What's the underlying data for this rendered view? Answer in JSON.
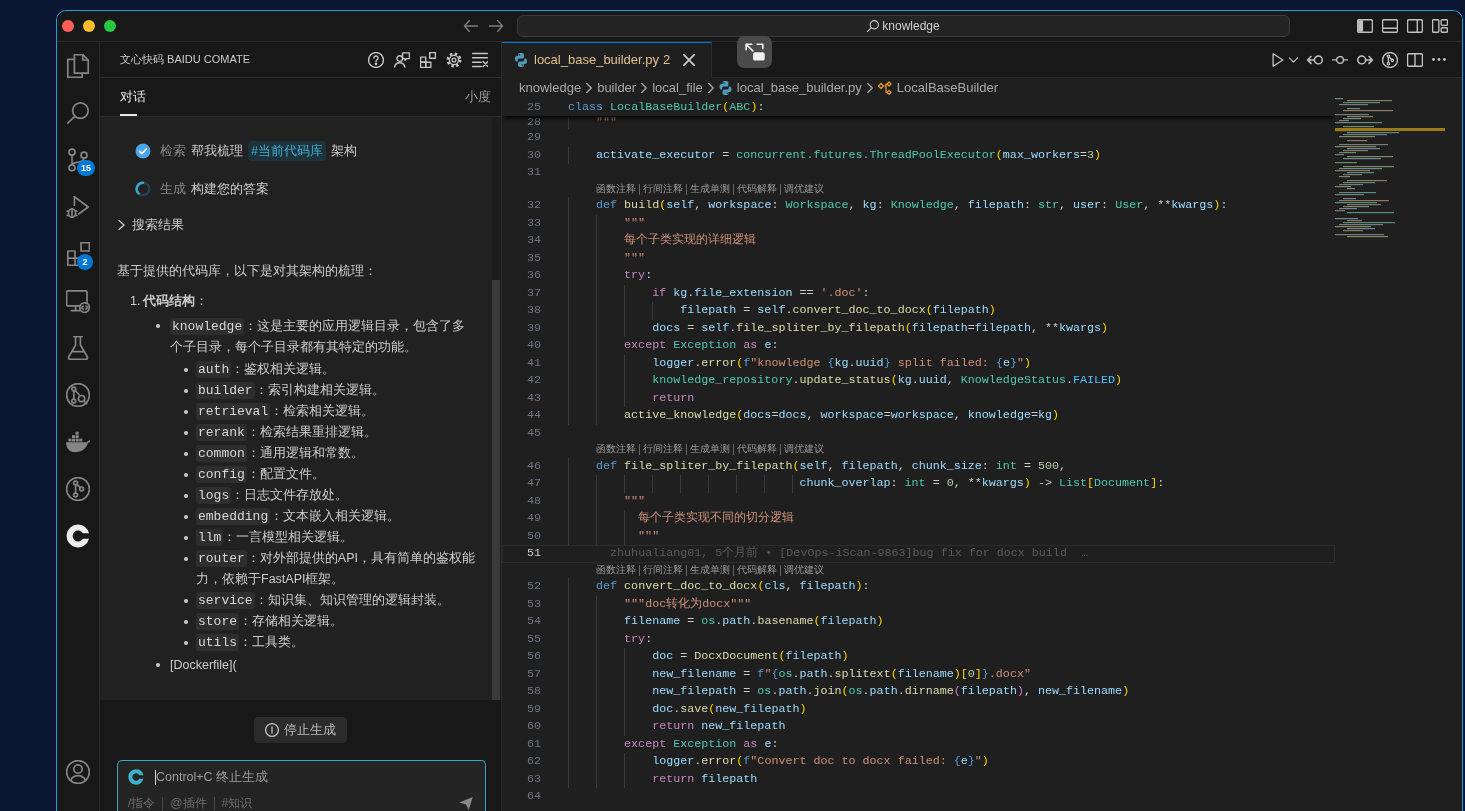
{
  "window": {
    "search": "knowledge"
  },
  "activity_bar": {
    "items": [
      {
        "selected": false
      },
      {
        "selected": false
      },
      {
        "selected": false,
        "badge": "15"
      },
      {
        "selected": false
      },
      {
        "selected": false,
        "badge": "2"
      },
      {
        "selected": false
      },
      {
        "selected": false
      },
      {
        "selected": false
      },
      {
        "selected": false
      },
      {
        "selected": false
      },
      {
        "selected": true
      }
    ]
  },
  "side_panel": {
    "title": "文心快码 BAIDU COMATE",
    "tabs": [
      {
        "label": "对话",
        "selected": true
      },
      {
        "label": "小度",
        "selected": false
      }
    ],
    "chat": {
      "steps": [
        {
          "done": true,
          "label": "检索",
          "parts": [
            {
              "kind": "text",
              "text": "帮我梳理"
            },
            {
              "kind": "tag",
              "text": "#当前代码库"
            },
            {
              "kind": "text",
              "text": "架构"
            }
          ]
        },
        {
          "done": false,
          "label": "生成",
          "parts": [
            {
              "kind": "text",
              "text": "构建您的答案"
            }
          ]
        }
      ],
      "search_results": {
        "label": "搜索结果",
        "expanded": false
      },
      "answer": {
        "intro": "基于提供的代码库，以下是对其架构的梳理：",
        "sections": [
          {
            "number": "1.",
            "heading": "**代码结构**：",
            "items": [
              {
                "code": "knowledge",
                "text": "：这是主要的应用逻辑目录，包含了多个子目录，每个子目录都有其特定的功能。",
                "children": [
                  {
                    "code": "auth",
                    "text": "：鉴权相关逻辑。"
                  },
                  {
                    "code": "builder",
                    "text": "：索引构建相关逻辑。"
                  },
                  {
                    "code": "retrieval",
                    "text": "：检索相关逻辑。"
                  },
                  {
                    "code": "rerank",
                    "text": "：检索结果重排逻辑。"
                  },
                  {
                    "code": "common",
                    "text": "：通用逻辑和常数。"
                  },
                  {
                    "code": "config",
                    "text": "：配置文件。"
                  },
                  {
                    "code": "logs",
                    "text": "：日志文件存放处。"
                  },
                  {
                    "code": "embedding",
                    "text": "：文本嵌入相关逻辑。"
                  },
                  {
                    "code": "llm",
                    "text": "：一言模型相关逻辑。"
                  },
                  {
                    "code": "router",
                    "text": "：对外部提供的API，具有简单的鉴权能力，依赖于FastAPI框架。"
                  },
                  {
                    "code": "service",
                    "text": "：知识集、知识管理的逻辑封装。"
                  },
                  {
                    "code": "store",
                    "text": "：存储相关逻辑。"
                  },
                  {
                    "code": "utils",
                    "text": "：工具类。"
                  }
                ]
              },
              {
                "text": "[Dockerfile]("
              }
            ]
          }
        ]
      }
    },
    "stop_button": "停止生成",
    "input": {
      "placeholder": "Control+C 终止生成",
      "focused": true,
      "shortcuts": [
        "/指令",
        "@插件",
        "#知识"
      ]
    }
  },
  "editor": {
    "tabs": [
      {
        "label": "local_base_builder.py",
        "problems": "2",
        "selected": true
      }
    ],
    "breadcrumb": [
      {
        "kind": "folder",
        "text": "knowledge"
      },
      {
        "kind": "folder",
        "text": "builder"
      },
      {
        "kind": "folder",
        "text": "local_file"
      },
      {
        "kind": "python",
        "text": "local_base_builder.py"
      },
      {
        "kind": "class",
        "text": "LocalBaseBuilder"
      }
    ],
    "sticky": {
      "number": "25",
      "tokens": [
        {
          "text": "class",
          "kind": "kw"
        },
        {
          "text": " LocalBaseBuilder",
          "kind": "type"
        },
        {
          "text": "(",
          "kind": "br1"
        },
        {
          "text": "ABC",
          "kind": "type"
        },
        {
          "text": ")",
          "kind": "br1"
        },
        {
          "text": ":",
          "kind": "op"
        }
      ]
    },
    "lines": [
      {
        "kind": "code",
        "number": "28",
        "current": false,
        "tokens": [
          {
            "text": "    \"\"\"",
            "kind": "str"
          }
        ]
      },
      {
        "kind": "code",
        "number": "29",
        "current": false
      },
      {
        "kind": "code",
        "number": "30",
        "current": false,
        "tokens": [
          {
            "text": "    activate_executor",
            "kind": "var"
          },
          {
            "text": " = ",
            "kind": "op"
          },
          {
            "text": "concurrent.futures.ThreadPoolExecutor",
            "kind": "type"
          },
          {
            "text": "(",
            "kind": "br1"
          },
          {
            "text": "max_workers",
            "kind": "var"
          },
          {
            "text": "=",
            "kind": "op"
          },
          {
            "text": "3",
            "kind": "num"
          },
          {
            "text": ")",
            "kind": "br1"
          }
        ]
      },
      {
        "kind": "code",
        "number": "31",
        "current": false
      },
      {
        "kind": "codelens",
        "links": [
          "函数注释",
          "行间注释",
          "生成单测",
          "代码解释",
          "调优建议"
        ]
      },
      {
        "kind": "code",
        "number": "32",
        "current": false,
        "tokens": [
          {
            "text": "    def",
            "kind": "kw"
          },
          {
            "text": " build",
            "kind": "fn"
          },
          {
            "text": "(",
            "kind": "br1"
          },
          {
            "text": "self",
            "kind": "var"
          },
          {
            "text": ", ",
            "kind": "op"
          },
          {
            "text": "workspace",
            "kind": "var"
          },
          {
            "text": ": ",
            "kind": "op"
          },
          {
            "text": "Workspace",
            "kind": "type"
          },
          {
            "text": ", ",
            "kind": "op"
          },
          {
            "text": "kg",
            "kind": "var"
          },
          {
            "text": ": ",
            "kind": "op"
          },
          {
            "text": "Knowledge",
            "kind": "type"
          },
          {
            "text": ", ",
            "kind": "op"
          },
          {
            "text": "filepath",
            "kind": "var"
          },
          {
            "text": ": ",
            "kind": "op"
          },
          {
            "text": "str",
            "kind": "type"
          },
          {
            "text": ", ",
            "kind": "op"
          },
          {
            "text": "user",
            "kind": "var"
          },
          {
            "text": ": ",
            "kind": "op"
          },
          {
            "text": "User",
            "kind": "type"
          },
          {
            "text": ", **",
            "kind": "op"
          },
          {
            "text": "kwargs",
            "kind": "var"
          },
          {
            "text": ")",
            "kind": "br1"
          },
          {
            "text": ":",
            "kind": "op"
          }
        ]
      },
      {
        "kind": "code",
        "number": "33",
        "current": false,
        "tokens": [
          {
            "text": "        \"\"\"",
            "kind": "str"
          }
        ]
      },
      {
        "kind": "code",
        "number": "34",
        "current": false,
        "tokens": [
          {
            "text": "        每个子类实现的详细逻辑",
            "kind": "str"
          }
        ]
      },
      {
        "kind": "code",
        "number": "35",
        "current": false,
        "tokens": [
          {
            "text": "        \"\"\"",
            "kind": "str"
          }
        ]
      },
      {
        "kind": "code",
        "number": "36",
        "current": false,
        "tokens": [
          {
            "text": "        try",
            "kind": "ctl"
          },
          {
            "text": ":",
            "kind": "op"
          }
        ]
      },
      {
        "kind": "code",
        "number": "37",
        "current": false,
        "tokens": [
          {
            "text": "            if",
            "kind": "ctl"
          },
          {
            "text": " kg",
            "kind": "var"
          },
          {
            "text": ".",
            "kind": "op"
          },
          {
            "text": "file_extension",
            "kind": "var"
          },
          {
            "text": " == ",
            "kind": "op"
          },
          {
            "text": "'.doc'",
            "kind": "str"
          },
          {
            "text": ":",
            "kind": "op"
          }
        ]
      },
      {
        "kind": "code",
        "number": "38",
        "current": false,
        "tokens": [
          {
            "text": "                filepath",
            "kind": "var"
          },
          {
            "text": " = ",
            "kind": "op"
          },
          {
            "text": "self",
            "kind": "var"
          },
          {
            "text": ".",
            "kind": "op"
          },
          {
            "text": "convert_doc_to_docx",
            "kind": "fn"
          },
          {
            "text": "(",
            "kind": "br1"
          },
          {
            "text": "filepath",
            "kind": "var"
          },
          {
            "text": ")",
            "kind": "br1"
          }
        ]
      },
      {
        "kind": "code",
        "number": "39",
        "current": false,
        "tokens": [
          {
            "text": "            docs",
            "kind": "var"
          },
          {
            "text": " = ",
            "kind": "op"
          },
          {
            "text": "self",
            "kind": "var"
          },
          {
            "text": ".",
            "kind": "op"
          },
          {
            "text": "file_spliter_by_filepath",
            "kind": "fn"
          },
          {
            "text": "(",
            "kind": "br1"
          },
          {
            "text": "filepath",
            "kind": "var"
          },
          {
            "text": "=",
            "kind": "op"
          },
          {
            "text": "filepath",
            "kind": "var"
          },
          {
            "text": ", **",
            "kind": "op"
          },
          {
            "text": "kwargs",
            "kind": "var"
          },
          {
            "text": ")",
            "kind": "br1"
          }
        ]
      },
      {
        "kind": "code",
        "number": "40",
        "current": false,
        "tokens": [
          {
            "text": "        except",
            "kind": "ctl"
          },
          {
            "text": " Exception",
            "kind": "type"
          },
          {
            "text": " as",
            "kind": "ctl"
          },
          {
            "text": " e",
            "kind": "var"
          },
          {
            "text": ":",
            "kind": "op"
          }
        ]
      },
      {
        "kind": "code",
        "number": "41",
        "current": false,
        "tokens": [
          {
            "text": "            logger",
            "kind": "var"
          },
          {
            "text": ".",
            "kind": "op"
          },
          {
            "text": "error",
            "kind": "fn"
          },
          {
            "text": "(",
            "kind": "br1"
          },
          {
            "text": "f",
            "kind": "kw"
          },
          {
            "text": "\"knowledge ",
            "kind": "str"
          },
          {
            "text": "{",
            "kind": "kw"
          },
          {
            "text": "kg",
            "kind": "var"
          },
          {
            "text": ".",
            "kind": "op"
          },
          {
            "text": "uuid",
            "kind": "var"
          },
          {
            "text": "}",
            "kind": "kw"
          },
          {
            "text": " split failed: ",
            "kind": "str"
          },
          {
            "text": "{",
            "kind": "kw"
          },
          {
            "text": "e",
            "kind": "var"
          },
          {
            "text": "}",
            "kind": "kw"
          },
          {
            "text": "\"",
            "kind": "str"
          },
          {
            "text": ")",
            "kind": "br1"
          }
        ]
      },
      {
        "kind": "code",
        "number": "42",
        "current": false,
        "tokens": [
          {
            "text": "            knowledge_repository",
            "kind": "type"
          },
          {
            "text": ".",
            "kind": "op"
          },
          {
            "text": "update_status",
            "kind": "fn"
          },
          {
            "text": "(",
            "kind": "br1"
          },
          {
            "text": "kg",
            "kind": "var"
          },
          {
            "text": ".",
            "kind": "op"
          },
          {
            "text": "uuid",
            "kind": "var"
          },
          {
            "text": ", ",
            "kind": "op"
          },
          {
            "text": "KnowledgeStatus",
            "kind": "type"
          },
          {
            "text": ".",
            "kind": "op"
          },
          {
            "text": "FAILED",
            "kind": "const"
          },
          {
            "text": ")",
            "kind": "br1"
          }
        ]
      },
      {
        "kind": "code",
        "number": "43",
        "current": false,
        "tokens": [
          {
            "text": "            return",
            "kind": "ctl"
          }
        ]
      },
      {
        "kind": "code",
        "number": "44",
        "current": false,
        "tokens": [
          {
            "text": "        active_knowledge",
            "kind": "fn"
          },
          {
            "text": "(",
            "kind": "br1"
          },
          {
            "text": "docs",
            "kind": "var"
          },
          {
            "text": "=",
            "kind": "op"
          },
          {
            "text": "docs",
            "kind": "var"
          },
          {
            "text": ", ",
            "kind": "op"
          },
          {
            "text": "workspace",
            "kind": "var"
          },
          {
            "text": "=",
            "kind": "op"
          },
          {
            "text": "workspace",
            "kind": "var"
          },
          {
            "text": ", ",
            "kind": "op"
          },
          {
            "text": "knowledge",
            "kind": "var"
          },
          {
            "text": "=",
            "kind": "op"
          },
          {
            "text": "kg",
            "kind": "var"
          },
          {
            "text": ")",
            "kind": "br1"
          }
        ]
      },
      {
        "kind": "code",
        "number": "45",
        "current": false
      },
      {
        "kind": "codelens",
        "links": [
          "函数注释",
          "行间注释",
          "生成单测",
          "代码解释",
          "调优建议"
        ]
      },
      {
        "kind": "code",
        "number": "46",
        "current": false,
        "tokens": [
          {
            "text": "    def",
            "kind": "kw"
          },
          {
            "text": " file_spliter_by_filepath",
            "kind": "fn"
          },
          {
            "text": "(",
            "kind": "br1"
          },
          {
            "text": "self",
            "kind": "var"
          },
          {
            "text": ", ",
            "kind": "op"
          },
          {
            "text": "filepath",
            "kind": "var"
          },
          {
            "text": ", ",
            "kind": "op"
          },
          {
            "text": "chunk_size",
            "kind": "var"
          },
          {
            "text": ": ",
            "kind": "op"
          },
          {
            "text": "int",
            "kind": "type"
          },
          {
            "text": " = ",
            "kind": "op"
          },
          {
            "text": "500",
            "kind": "num"
          },
          {
            "text": ",",
            "kind": "op"
          }
        ]
      },
      {
        "kind": "code",
        "number": "47",
        "current": false,
        "tokens": [
          {
            "text": "                                 chunk_overlap",
            "kind": "var"
          },
          {
            "text": ": ",
            "kind": "op"
          },
          {
            "text": "int",
            "kind": "type"
          },
          {
            "text": " = ",
            "kind": "op"
          },
          {
            "text": "0",
            "kind": "num"
          },
          {
            "text": ", **",
            "kind": "op"
          },
          {
            "text": "kwargs",
            "kind": "var"
          },
          {
            "text": ")",
            "kind": "br1"
          },
          {
            "text": " -> ",
            "kind": "op"
          },
          {
            "text": "List",
            "kind": "type"
          },
          {
            "text": "[",
            "kind": "br1"
          },
          {
            "text": "Document",
            "kind": "type"
          },
          {
            "text": "]",
            "kind": "br1"
          },
          {
            "text": ":",
            "kind": "op"
          }
        ]
      },
      {
        "kind": "code",
        "number": "48",
        "current": false,
        "tokens": [
          {
            "text": "        \"\"\"",
            "kind": "str"
          }
        ]
      },
      {
        "kind": "code",
        "number": "49",
        "current": false,
        "tokens": [
          {
            "text": "          每个子类实现不同的切分逻辑",
            "kind": "str"
          }
        ]
      },
      {
        "kind": "code",
        "number": "50",
        "current": false,
        "tokens": [
          {
            "text": "          \"\"\"",
            "kind": "str"
          }
        ]
      },
      {
        "kind": "code",
        "number": "51",
        "current": true,
        "blame": "zhuhualiang01, 5个月前 • [DevOps-iScan-9863]bug fix for docx build  …"
      },
      {
        "kind": "codelens",
        "links": [
          "函数注释",
          "行间注释",
          "生成单测",
          "代码解释",
          "调优建议"
        ]
      },
      {
        "kind": "code",
        "number": "52",
        "current": false,
        "tokens": [
          {
            "text": "    def",
            "kind": "kw"
          },
          {
            "text": " convert_doc_to_docx",
            "kind": "fn"
          },
          {
            "text": "(",
            "kind": "br1"
          },
          {
            "text": "cls",
            "kind": "var"
          },
          {
            "text": ", ",
            "kind": "op"
          },
          {
            "text": "filepath",
            "kind": "var"
          },
          {
            "text": ")",
            "kind": "br1"
          },
          {
            "text": ":",
            "kind": "op"
          }
        ]
      },
      {
        "kind": "code",
        "number": "53",
        "current": false,
        "tokens": [
          {
            "text": "        \"\"\"doc转化为docx\"\"\"",
            "kind": "str"
          }
        ]
      },
      {
        "kind": "code",
        "number": "54",
        "current": false,
        "tokens": [
          {
            "text": "        filename",
            "kind": "var"
          },
          {
            "text": " = ",
            "kind": "op"
          },
          {
            "text": "os",
            "kind": "type"
          },
          {
            "text": ".",
            "kind": "op"
          },
          {
            "text": "path",
            "kind": "var"
          },
          {
            "text": ".",
            "kind": "op"
          },
          {
            "text": "basename",
            "kind": "fn"
          },
          {
            "text": "(",
            "kind": "br1"
          },
          {
            "text": "filepath",
            "kind": "var"
          },
          {
            "text": ")",
            "kind": "br1"
          }
        ]
      },
      {
        "kind": "code",
        "number": "55",
        "current": false,
        "tokens": [
          {
            "text": "        try",
            "kind": "ctl"
          },
          {
            "text": ":",
            "kind": "op"
          }
        ]
      },
      {
        "kind": "code",
        "number": "56",
        "current": false,
        "tokens": [
          {
            "text": "            doc",
            "kind": "var"
          },
          {
            "text": " = ",
            "kind": "op"
          },
          {
            "text": "DocxDocument",
            "kind": "fn"
          },
          {
            "text": "(",
            "kind": "br1"
          },
          {
            "text": "filepath",
            "kind": "var"
          },
          {
            "text": ")",
            "kind": "br1"
          }
        ]
      },
      {
        "kind": "code",
        "number": "57",
        "current": false,
        "tokens": [
          {
            "text": "            new_filename",
            "kind": "var"
          },
          {
            "text": " = ",
            "kind": "op"
          },
          {
            "text": "f",
            "kind": "kw"
          },
          {
            "text": "\"",
            "kind": "str"
          },
          {
            "text": "{",
            "kind": "kw"
          },
          {
            "text": "os",
            "kind": "type"
          },
          {
            "text": ".",
            "kind": "op"
          },
          {
            "text": "path",
            "kind": "var"
          },
          {
            "text": ".",
            "kind": "op"
          },
          {
            "text": "splitext",
            "kind": "fn"
          },
          {
            "text": "(",
            "kind": "br1"
          },
          {
            "text": "filename",
            "kind": "var"
          },
          {
            "text": ")",
            "kind": "br1"
          },
          {
            "text": "[",
            "kind": "br1"
          },
          {
            "text": "0",
            "kind": "num"
          },
          {
            "text": "]",
            "kind": "br1"
          },
          {
            "text": "}",
            "kind": "kw"
          },
          {
            "text": ".docx\"",
            "kind": "str"
          }
        ]
      },
      {
        "kind": "code",
        "number": "58",
        "current": false,
        "tokens": [
          {
            "text": "            new_filepath",
            "kind": "var"
          },
          {
            "text": " = ",
            "kind": "op"
          },
          {
            "text": "os",
            "kind": "type"
          },
          {
            "text": ".",
            "kind": "op"
          },
          {
            "text": "path",
            "kind": "var"
          },
          {
            "text": ".",
            "kind": "op"
          },
          {
            "text": "join",
            "kind": "fn"
          },
          {
            "text": "(",
            "kind": "br1"
          },
          {
            "text": "os",
            "kind": "type"
          },
          {
            "text": ".",
            "kind": "op"
          },
          {
            "text": "path",
            "kind": "var"
          },
          {
            "text": ".",
            "kind": "op"
          },
          {
            "text": "dirname",
            "kind": "fn"
          },
          {
            "text": "(",
            "kind": "br2"
          },
          {
            "text": "filepath",
            "kind": "var"
          },
          {
            "text": ")",
            "kind": "br2"
          },
          {
            "text": ", ",
            "kind": "op"
          },
          {
            "text": "new_filename",
            "kind": "var"
          },
          {
            "text": ")",
            "kind": "br1"
          }
        ]
      },
      {
        "kind": "code",
        "number": "59",
        "current": false,
        "tokens": [
          {
            "text": "            doc",
            "kind": "var"
          },
          {
            "text": ".",
            "kind": "op"
          },
          {
            "text": "save",
            "kind": "fn"
          },
          {
            "text": "(",
            "kind": "br1"
          },
          {
            "text": "new_filepath",
            "kind": "var"
          },
          {
            "text": ")",
            "kind": "br1"
          }
        ]
      },
      {
        "kind": "code",
        "number": "60",
        "current": false,
        "tokens": [
          {
            "text": "            return",
            "kind": "ctl"
          },
          {
            "text": " new_filepath",
            "kind": "var"
          }
        ]
      },
      {
        "kind": "code",
        "number": "61",
        "current": false,
        "tokens": [
          {
            "text": "        except",
            "kind": "ctl"
          },
          {
            "text": " Exception",
            "kind": "type"
          },
          {
            "text": " as",
            "kind": "ctl"
          },
          {
            "text": " e",
            "kind": "var"
          },
          {
            "text": ":",
            "kind": "op"
          }
        ]
      },
      {
        "kind": "code",
        "number": "62",
        "current": false,
        "tokens": [
          {
            "text": "            logger",
            "kind": "var"
          },
          {
            "text": ".",
            "kind": "op"
          },
          {
            "text": "error",
            "kind": "fn"
          },
          {
            "text": "(",
            "kind": "br1"
          },
          {
            "text": "f",
            "kind": "kw"
          },
          {
            "text": "\"Convert doc to docx failed: ",
            "kind": "str"
          },
          {
            "text": "{",
            "kind": "kw"
          },
          {
            "text": "e",
            "kind": "var"
          },
          {
            "text": "}",
            "kind": "kw"
          },
          {
            "text": "\"",
            "kind": "str"
          },
          {
            "text": ")",
            "kind": "br1"
          }
        ]
      },
      {
        "kind": "code",
        "number": "63",
        "current": false,
        "tokens": [
          {
            "text": "            return",
            "kind": "ctl"
          },
          {
            "text": " filepath",
            "kind": "var"
          }
        ]
      },
      {
        "kind": "code",
        "number": "64",
        "current": false
      }
    ]
  }
}
